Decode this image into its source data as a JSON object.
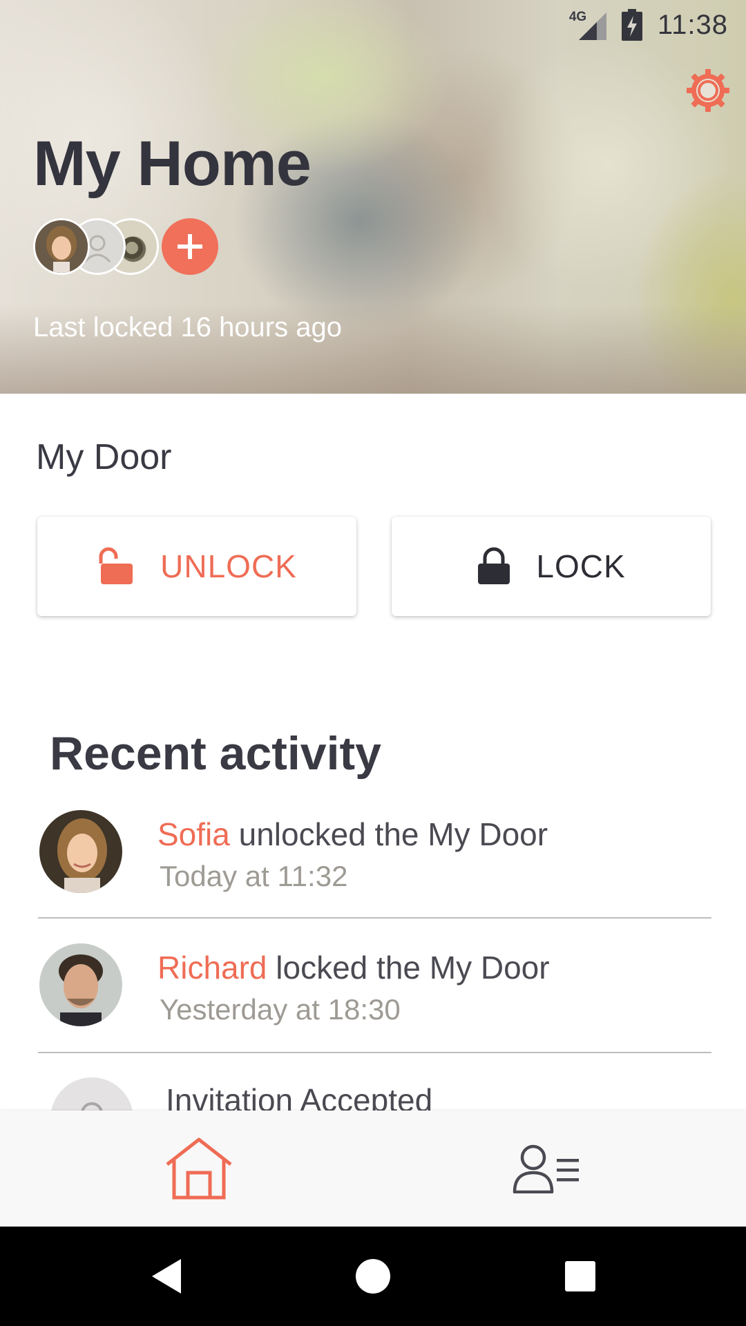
{
  "status_bar": {
    "network": "4G",
    "time": "11:38"
  },
  "header": {
    "title": "My Home",
    "last_locked": "Last locked 16 hours ago"
  },
  "door": {
    "name": "My Door",
    "unlock_label": "UNLOCK",
    "lock_label": "LOCK"
  },
  "activity": {
    "title": "Recent activity",
    "items": [
      {
        "name": "Sofia",
        "action": " unlocked the My Door",
        "time": "Today at 11:32"
      },
      {
        "name": "Richard",
        "action": " locked the My Door",
        "time": "Yesterday at 18:30"
      }
    ],
    "partial_item": "Invitation Accepted"
  },
  "icons": {
    "settings": "gear-icon",
    "add_member": "plus-icon",
    "unlock": "open-padlock-icon",
    "lock": "padlock-icon",
    "nav_home": "home-icon",
    "nav_people": "people-list-icon"
  },
  "colors": {
    "accent": "#ef6c55",
    "text_dark": "#3a3a44",
    "text_muted": "#9e9a94",
    "nav_bg": "#f8f8f8"
  }
}
